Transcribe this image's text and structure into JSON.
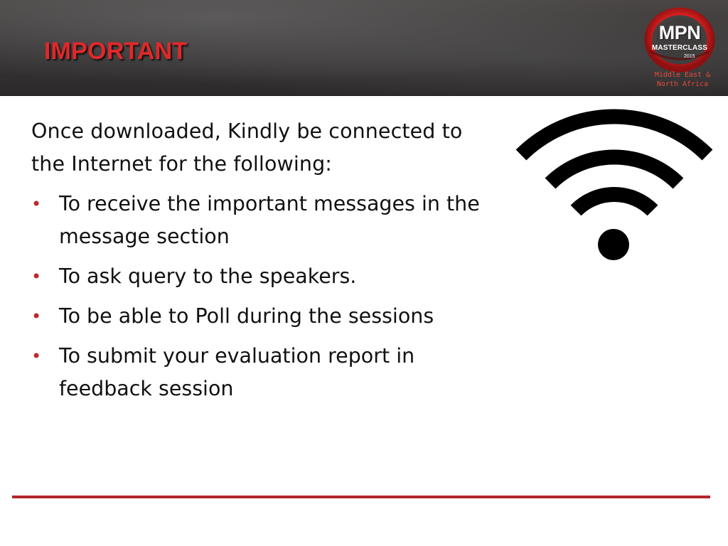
{
  "slide": {
    "title": "IMPORTANT",
    "intro": "Once downloaded, Kindly be connected to the Internet for the following:",
    "bullets": [
      "To receive the important messages in the message section",
      "To ask query to the speakers.",
      "To be able to Poll during the sessions",
      "To submit your evaluation report in feedback session"
    ],
    "bullet_glyph": "•"
  },
  "logo": {
    "name": "MPN",
    "line": "MASTERCLASS",
    "year": "2015",
    "region_line1": "Middle East &",
    "region_line2": "North Africa"
  },
  "icons": {
    "main": "wifi-icon",
    "brand": "mpn-logo"
  },
  "colors": {
    "accent": "#e0282a",
    "bullet": "#c0272d",
    "divider": "#b3252b",
    "header_bg": "#3b3838",
    "text": "#111111"
  }
}
